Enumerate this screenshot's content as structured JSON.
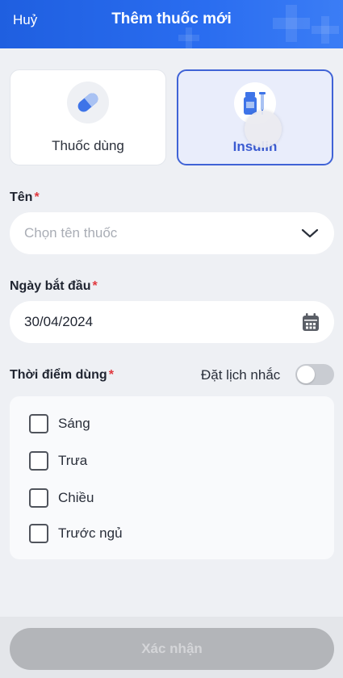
{
  "header": {
    "cancel_label": "Huỷ",
    "title": "Thêm thuốc mới"
  },
  "medicine_types": [
    {
      "label": "Thuốc dùng",
      "icon": "pill-icon",
      "selected": false
    },
    {
      "label": "Insulin",
      "icon": "insulin-vial-icon",
      "selected": true
    }
  ],
  "name_field": {
    "label": "Tên",
    "required_mark": "*",
    "placeholder": "Chọn tên thuốc",
    "icon": "chevron-down-icon"
  },
  "start_date": {
    "label": "Ngày bắt đầu",
    "required_mark": "*",
    "value": "30/04/2024",
    "icon": "calendar-icon"
  },
  "time_of_use": {
    "label": "Thời điểm dùng",
    "required_mark": "*",
    "reminder_label": "Đặt lịch nhắc",
    "reminder_on": false,
    "options": [
      {
        "label": "Sáng",
        "checked": false
      },
      {
        "label": "Trưa",
        "checked": false
      },
      {
        "label": "Chiều",
        "checked": false
      },
      {
        "label": "Trước ngủ",
        "checked": false
      }
    ]
  },
  "confirm_label": "Xác nhận",
  "colors": {
    "primary": "#2a6df0",
    "selected_border": "#4063d6",
    "required": "#e0383e",
    "disabled_button": "#b3b5b9"
  }
}
